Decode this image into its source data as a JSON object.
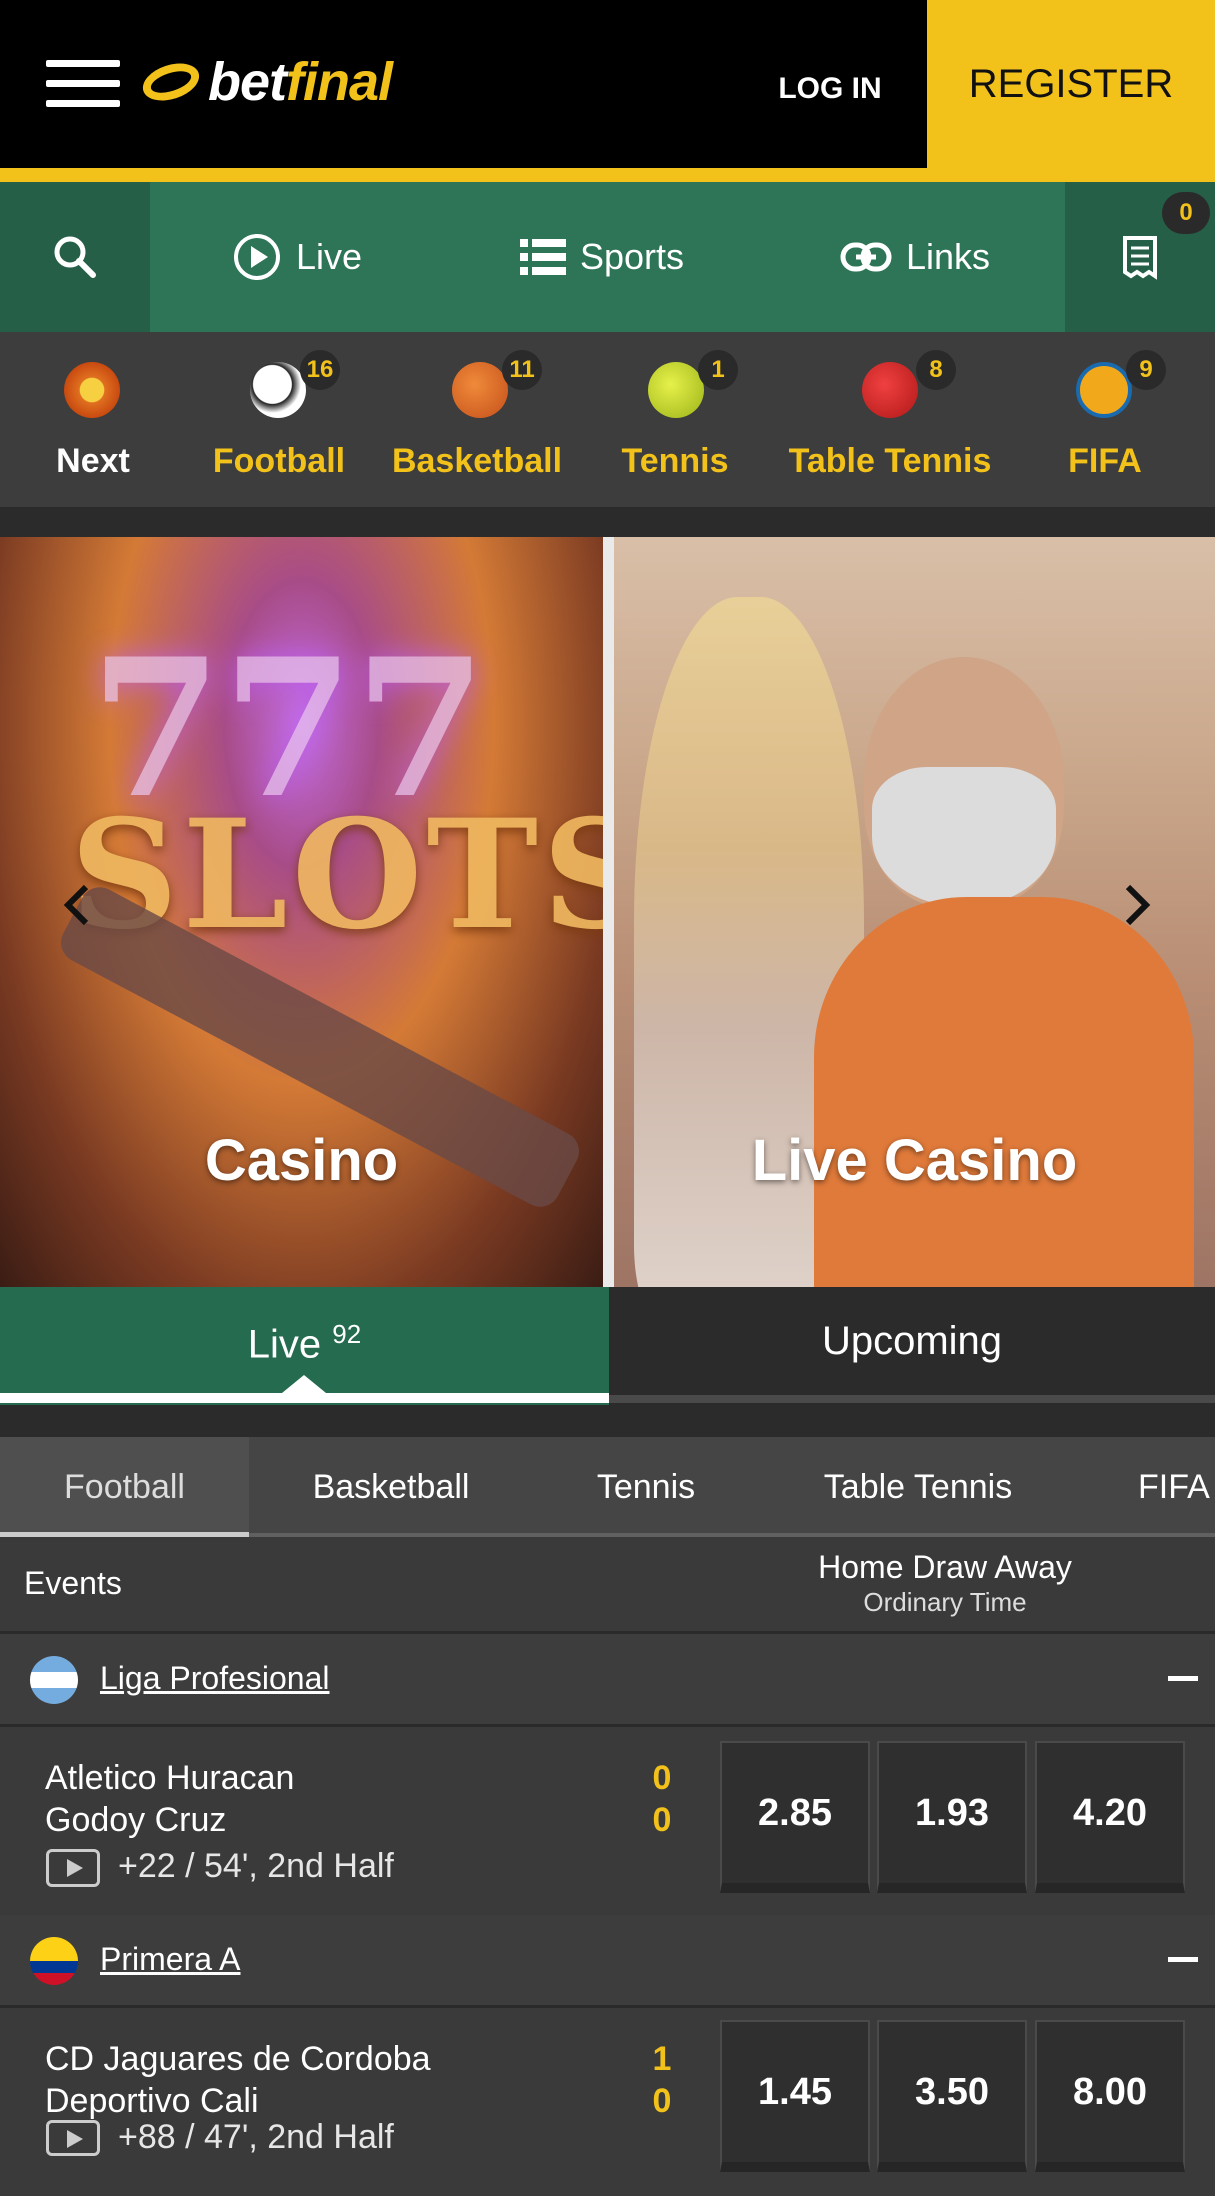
{
  "header": {
    "logo_part1": "bet",
    "logo_part2": "final",
    "login_label": "LOG IN",
    "register_label": "REGISTER",
    "accent_color": "#f2c21b"
  },
  "nav": {
    "live_label": "Live",
    "sports_label": "Sports",
    "links_label": "Links",
    "betslip_count": "0"
  },
  "sports": [
    {
      "label": "Next",
      "count": "",
      "icon": "clock-icon"
    },
    {
      "label": "Football",
      "count": "16",
      "icon": "football-icon"
    },
    {
      "label": "Basketball",
      "count": "11",
      "icon": "basketball-icon"
    },
    {
      "label": "Tennis",
      "count": "1",
      "icon": "tennis-ball-icon"
    },
    {
      "label": "Table Tennis",
      "count": "8",
      "icon": "table-tennis-icon"
    },
    {
      "label": "FIFA",
      "count": "9",
      "icon": "fifa-icon"
    }
  ],
  "banners": {
    "casino_title": "Casino",
    "casino_art_sevens": "777",
    "casino_art_slots": "SLOTS",
    "live_casino_title": "Live Casino"
  },
  "tabs": {
    "live_label": "Live",
    "live_count": "92",
    "upcoming_label": "Upcoming"
  },
  "filter_tabs": [
    "Football",
    "Basketball",
    "Tennis",
    "Table Tennis",
    "FIFA"
  ],
  "events_header": {
    "events_label": "Events",
    "market_label": "Home Draw Away",
    "market_sub": "Ordinary Time"
  },
  "leagues": [
    {
      "name": "Liga Profesional",
      "match": {
        "home": "Atletico Huracan",
        "away": "Godoy Cruz",
        "home_score": "0",
        "away_score": "0",
        "info": "+22 / 54', 2nd Half",
        "odds": [
          "2.85",
          "1.93",
          "4.20"
        ]
      }
    },
    {
      "name": "Primera A",
      "match": {
        "home": "CD Jaguares de Cordoba",
        "away": "Deportivo Cali",
        "home_score": "1",
        "away_score": "0",
        "info": "+88 / 47', 2nd Half",
        "odds": [
          "1.45",
          "3.50",
          "8.00"
        ]
      }
    }
  ]
}
